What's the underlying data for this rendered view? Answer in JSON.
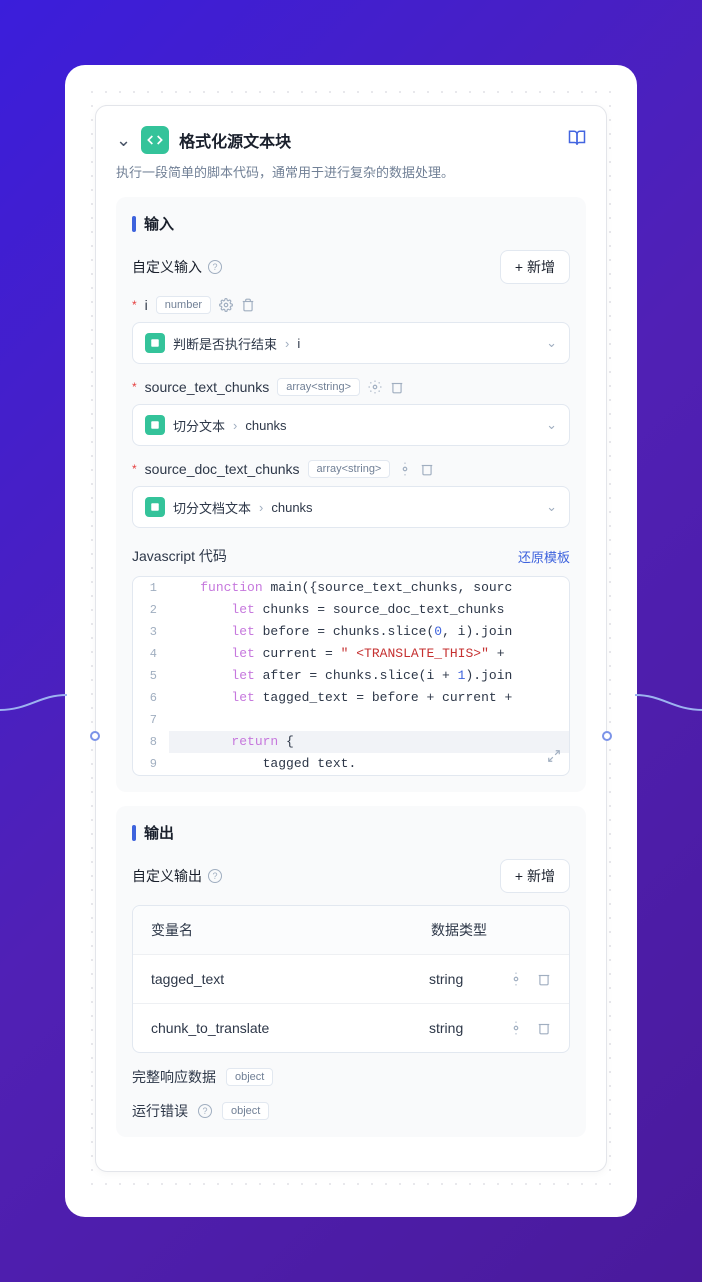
{
  "header": {
    "title": "格式化源文本块",
    "description": "执行一段简单的脚本代码，通常用于进行复杂的数据处理。"
  },
  "input_section": {
    "title": "输入",
    "custom_input_label": "自定义输入",
    "add_button": "新增"
  },
  "inputs": [
    {
      "name": "i",
      "type": "number",
      "ref_node": "判断是否执行结束",
      "ref_var": "i"
    },
    {
      "name": "source_text_chunks",
      "type": "array<string>",
      "ref_node": "切分文本",
      "ref_var": "chunks"
    },
    {
      "name": "source_doc_text_chunks",
      "type": "array<string>",
      "ref_node": "切分文档文本",
      "ref_var": "chunks"
    }
  ],
  "code": {
    "title": "Javascript 代码",
    "restore": "还原模板",
    "lines": [
      {
        "n": "1",
        "pre": "    ",
        "kw": "function",
        "t1": " main({source_text_chunks, sourc"
      },
      {
        "n": "2",
        "pre": "        ",
        "kw": "let",
        "t1": " chunks = source_doc_text_chunks"
      },
      {
        "n": "3",
        "pre": "        ",
        "kw": "let",
        "t1": " before = chunks.slice(",
        "num1": "0",
        "t2": ", i).join"
      },
      {
        "n": "4",
        "pre": "        ",
        "kw": "let",
        "t1": " current = ",
        "str": "\" <TRANSLATE_THIS>\"",
        "t2": " +"
      },
      {
        "n": "5",
        "pre": "        ",
        "kw": "let",
        "t1": " after = chunks.slice(i + ",
        "num1": "1",
        "t2": ").join"
      },
      {
        "n": "6",
        "pre": "        ",
        "kw": "let",
        "t1": " tagged_text = before + current +"
      },
      {
        "n": "7",
        "pre": "",
        "t1": ""
      },
      {
        "n": "8",
        "pre": "        ",
        "kw": "return",
        "t1": " {",
        "hl": true
      },
      {
        "n": "9",
        "pre": "            ",
        "t1": "tagged text."
      }
    ]
  },
  "output_section": {
    "title": "输出",
    "custom_output_label": "自定义输出",
    "add_button": "新增",
    "col_name": "变量名",
    "col_type": "数据类型"
  },
  "outputs": [
    {
      "name": "tagged_text",
      "type": "string"
    },
    {
      "name": "chunk_to_translate",
      "type": "string"
    }
  ],
  "full_response": {
    "label": "完整响应数据",
    "type": "object"
  },
  "run_error": {
    "label": "运行错误",
    "type": "object"
  }
}
